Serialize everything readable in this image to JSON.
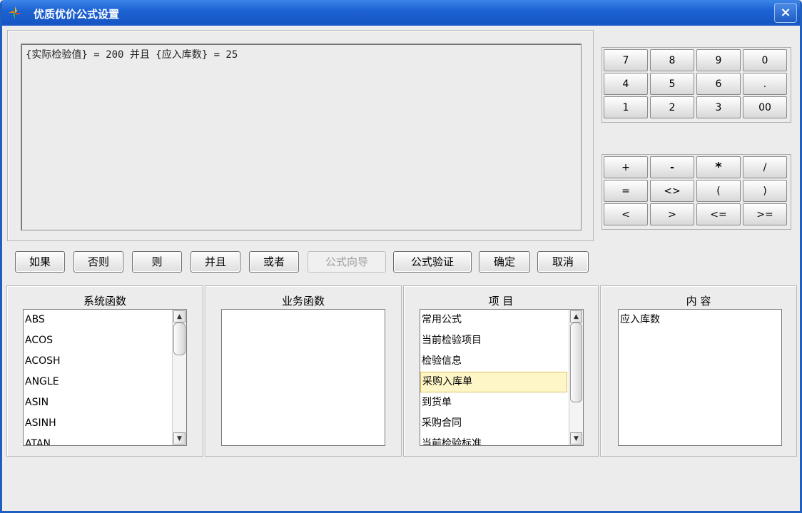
{
  "window": {
    "title": "优质优价公式设置",
    "close_label": "×"
  },
  "formula": {
    "text": "{实际检验值} = 200 并且 {应入库数} = 25"
  },
  "buttons": [
    "如果",
    "否则",
    "则",
    "并且",
    "或者",
    "公式向导",
    "公式验证",
    "确定",
    "取消"
  ],
  "numpad": [
    [
      "7",
      "8",
      "9",
      "0"
    ],
    [
      "4",
      "5",
      "6",
      "."
    ],
    [
      "1",
      "2",
      "3",
      "00"
    ]
  ],
  "operators": [
    [
      "+",
      "-",
      "*",
      "/"
    ],
    [
      "=",
      "<>",
      "(",
      ")"
    ],
    [
      "<",
      ">",
      "<=",
      ">="
    ]
  ],
  "system_functions": {
    "title": "系统函数",
    "items": [
      "ABS",
      "ACOS",
      "ACOSH",
      "ANGLE",
      "ASIN",
      "ASINH",
      "ATAN"
    ]
  },
  "business_functions": {
    "title": "业务函数",
    "items": []
  },
  "project": {
    "title": "项 目",
    "items": [
      "常用公式",
      "当前检验项目",
      "检验信息",
      "采购入库单",
      "到货单",
      "采购合同",
      "当前检验标准"
    ],
    "selected": "采购入库单"
  },
  "content": {
    "title": "内 容",
    "items": [
      "应入库数"
    ]
  },
  "icons": {
    "app": "app-logo-icon",
    "close": "close-icon",
    "scroll_up": "arrow-up-icon",
    "scroll_down": "arrow-down-icon"
  }
}
